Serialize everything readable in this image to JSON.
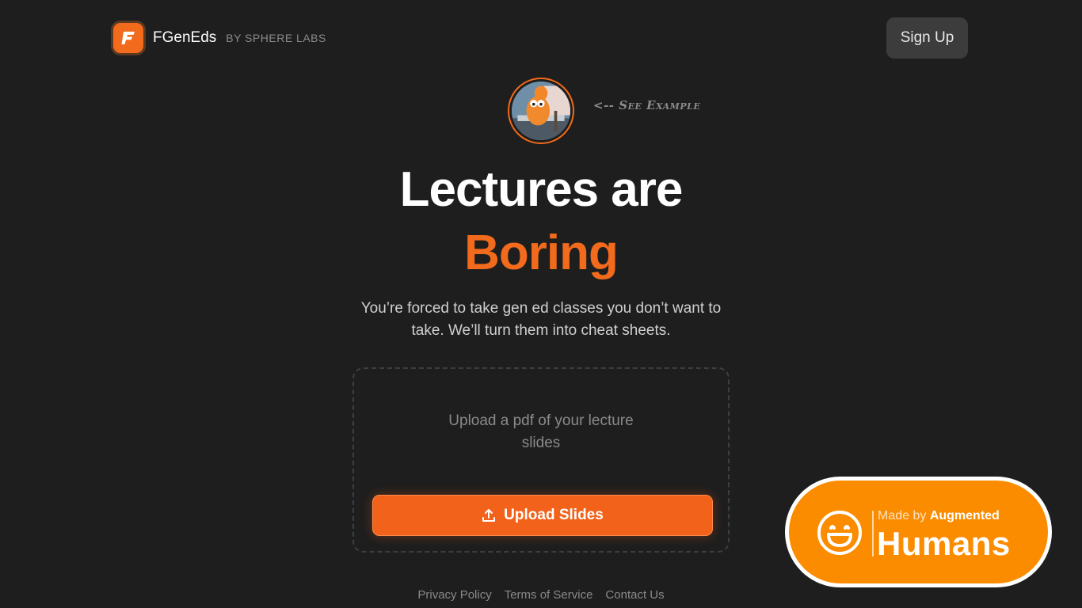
{
  "header": {
    "brand_name": "FGenEds",
    "brand_sub": "BY SPHERE LABS",
    "signup_label": "Sign Up",
    "logo_letter": "F"
  },
  "example": {
    "label": "<-- See Example"
  },
  "hero": {
    "line1": "Lectures are",
    "line2": "Boring",
    "subtitle": "You’re forced to take gen ed classes you don’t want to take. We’ll turn them into cheat sheets."
  },
  "upload": {
    "hint": "Upload a pdf of your lecture slides",
    "button_label": "Upload Slides",
    "icon": "upload-icon"
  },
  "footer": {
    "links": [
      "Privacy Policy",
      "Terms of Service",
      "Contact Us"
    ]
  },
  "badge": {
    "made_by_prefix": "Made by",
    "made_by_name": "Augmented",
    "humans": "Humans",
    "icon": "smile-icon"
  },
  "colors": {
    "background": "#1e1e1e",
    "accent": "#f26a1b",
    "badge": "#fb8c00"
  }
}
